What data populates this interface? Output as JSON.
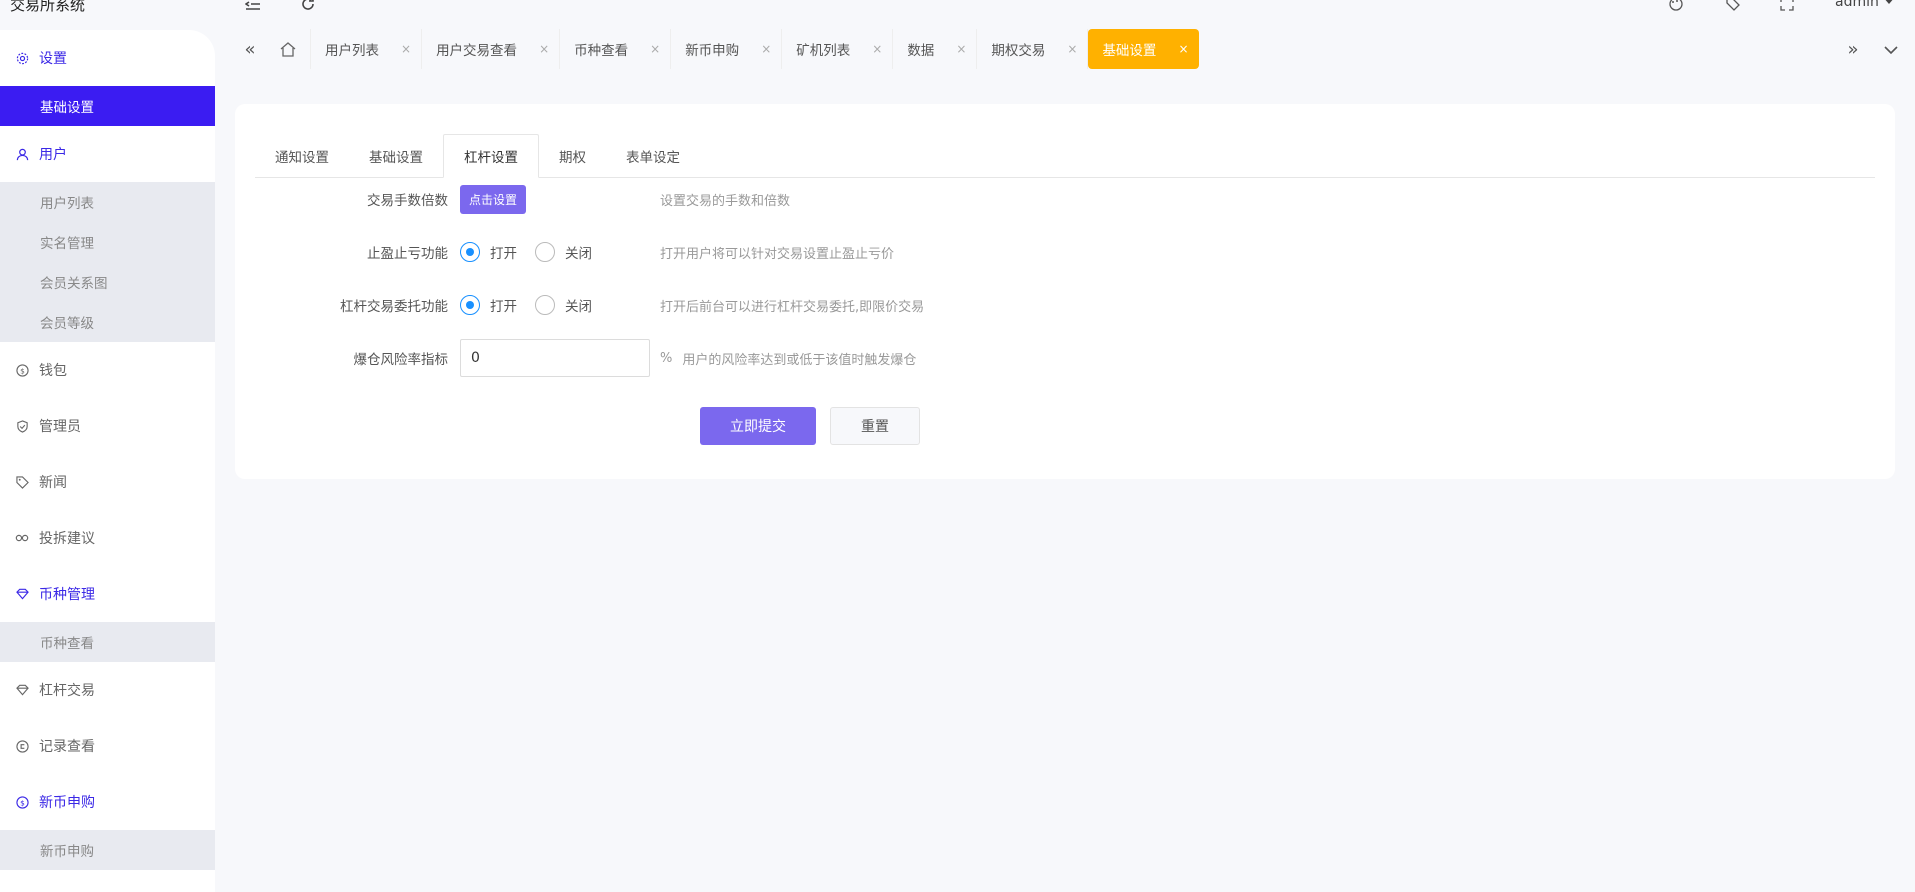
{
  "app": {
    "title": "交易所系统",
    "user": "admin"
  },
  "topbar": {
    "icons": [
      "menu-fold-icon",
      "refresh-icon",
      "theme-icon",
      "tag-icon",
      "fullscreen-icon"
    ]
  },
  "sidebar": {
    "groups": [
      {
        "label": "设置",
        "icon": "gear-icon",
        "active": true,
        "items": [
          {
            "label": "基础设置",
            "selected": true
          }
        ]
      },
      {
        "label": "用户",
        "icon": "user-icon",
        "active": true,
        "items": [
          {
            "label": "用户列表"
          },
          {
            "label": "实名管理"
          },
          {
            "label": "会员关系图"
          },
          {
            "label": "会员等级"
          }
        ]
      },
      {
        "label": "钱包",
        "icon": "dollar-icon",
        "active": false,
        "items": []
      },
      {
        "label": "管理员",
        "icon": "shield-icon",
        "active": false,
        "items": []
      },
      {
        "label": "新闻",
        "icon": "tag-icon",
        "active": false,
        "items": []
      },
      {
        "label": "投拆建议",
        "icon": "link-icon",
        "active": false,
        "items": []
      },
      {
        "label": "币种管理",
        "icon": "diamond-icon",
        "active": true,
        "items": [
          {
            "label": "币种查看"
          }
        ]
      },
      {
        "label": "杠杆交易",
        "icon": "diamond-icon",
        "active": false,
        "items": []
      },
      {
        "label": "记录查看",
        "icon": "record-icon",
        "active": false,
        "items": []
      },
      {
        "label": "新币申购",
        "icon": "dollar-icon",
        "active": true,
        "items": [
          {
            "label": "新币申购"
          }
        ]
      }
    ]
  },
  "tabs": {
    "items": [
      {
        "label": "用户列表"
      },
      {
        "label": "用户交易查看"
      },
      {
        "label": "币种查看"
      },
      {
        "label": "新币申购"
      },
      {
        "label": "矿机列表"
      },
      {
        "label": "数据"
      },
      {
        "label": "期权交易"
      },
      {
        "label": "基础设置",
        "current": true
      }
    ],
    "close_glyph": "×"
  },
  "form": {
    "tabs": [
      {
        "label": "通知设置"
      },
      {
        "label": "基础设置"
      },
      {
        "label": "杠杆设置",
        "active": true
      },
      {
        "label": "期权"
      },
      {
        "label": "表单设定"
      }
    ],
    "fee": {
      "label": "交易手数倍数",
      "button": "点击设置",
      "hint": "设置交易的手数和倍数"
    },
    "stop": {
      "label": "止盈止亏功能",
      "on": "打开",
      "off": "关闭",
      "value": "打开",
      "hint": "打开用户将可以针对交易设置止盈止亏价"
    },
    "entrust": {
      "label": "杠杆交易委托功能",
      "on": "打开",
      "off": "关闭",
      "value": "打开",
      "hint": "打开后前台可以进行杠杆交易委托,即限价交易"
    },
    "risk": {
      "label": "爆仓风险率指标",
      "value": "0",
      "unit": "%",
      "hint": "用户的风险率达到或低于该值时触发爆仓"
    },
    "submit": "立即提交",
    "reset": "重置"
  },
  "colors": {
    "primary": "#7b68ee",
    "sidebar_selected": "#3b1cf2",
    "tab_current": "#ffb100",
    "radio": "#1890ff"
  }
}
